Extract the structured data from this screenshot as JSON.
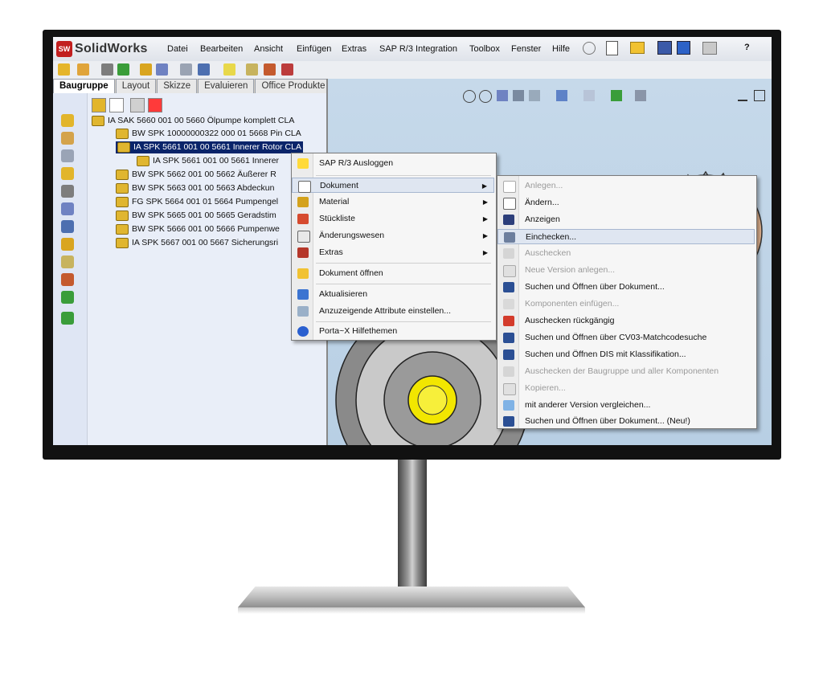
{
  "app": {
    "brand": "SolidWorks",
    "logo_text": "SW"
  },
  "menubar": {
    "items": [
      "Datei",
      "Bearbeiten",
      "Ansicht",
      "Einfügen",
      "Extras",
      "SAP R/3 Integration",
      "Toolbox",
      "Fenster",
      "Hilfe"
    ],
    "right_help": "?"
  },
  "tabs": [
    "Baugruppe",
    "Layout",
    "Skizze",
    "Evaluieren",
    "Office Produkte"
  ],
  "tree": {
    "items": [
      "IA SAK 5660 001 00 5660 Ölpumpe komplett CLA",
      "BW SPK 10000000322 000 01 5668 Pin CLA",
      "IA SPK 5661 001 00 5661 Innerer Rotor CLA",
      "IA SPK 5661 001 00 5661 Innerer",
      "BW SPK 5662 001 00 5662 Äußerer R",
      "BW SPK 5663 001 00 5663 Abdeckun",
      "FG SPK 5664 001 01 5664 Pumpengel",
      "BW SPK 5665 001 00 5665 Geradstim",
      "BW SPK 5666 001 00 5666 Pumpenwe",
      "IA SPK 5667 001 00 5667 Sicherungsri"
    ]
  },
  "context_menu": {
    "items": [
      {
        "label": "SAP R/3 Ausloggen",
        "icon": "sap-logout-icon"
      },
      {
        "label": "Dokument",
        "icon": "document-icon",
        "submenu": true
      },
      {
        "label": "Material",
        "icon": "material-icon",
        "submenu": true
      },
      {
        "label": "Stückliste",
        "icon": "bom-icon",
        "submenu": true
      },
      {
        "label": "Änderungswesen",
        "icon": "change-icon",
        "submenu": true
      },
      {
        "label": "Extras",
        "icon": "extras-icon",
        "submenu": true
      },
      {
        "label": "Dokument öffnen",
        "icon": "open-folder-icon"
      },
      {
        "label": "Aktualisieren",
        "icon": "refresh-icon"
      },
      {
        "label": "Anzuzeigende Attribute einstellen...",
        "icon": "attributes-icon"
      },
      {
        "label": "Porta~X Hilfethemen",
        "icon": "help-icon"
      }
    ]
  },
  "submenu": {
    "items": [
      {
        "label": "Anlegen...",
        "disabled": true
      },
      {
        "label": "Ändern...",
        "disabled": false
      },
      {
        "label": "Anzeigen",
        "disabled": false
      },
      {
        "label": "Einchecken...",
        "disabled": false
      },
      {
        "label": "Auschecken",
        "disabled": true
      },
      {
        "label": "Neue Version anlegen...",
        "disabled": true
      },
      {
        "label": "Suchen und Öffnen über Dokument...",
        "disabled": false
      },
      {
        "label": "Komponenten einfügen...",
        "disabled": true
      },
      {
        "label": "Auschecken rückgängig",
        "disabled": false
      },
      {
        "label": "Suchen und Öffnen über CV03-Matchcodesuche",
        "disabled": false
      },
      {
        "label": "Suchen und Öffnen DIS mit Klassifikation...",
        "disabled": false
      },
      {
        "label": "Auschecken der Baugruppe und aller Komponenten",
        "disabled": true
      },
      {
        "label": "Kopieren...",
        "disabled": true
      },
      {
        "label": "mit anderer Version vergleichen...",
        "disabled": false
      },
      {
        "label": "Suchen und Öffnen über Dokument... (Neu!)",
        "disabled": false
      }
    ]
  },
  "colors": {
    "selection": "#0a246a",
    "brand_red": "#c21f1f",
    "gear": "#e8b894",
    "pump_gray": "#9a9a9a",
    "rotor_yellow": "#f2e600"
  }
}
